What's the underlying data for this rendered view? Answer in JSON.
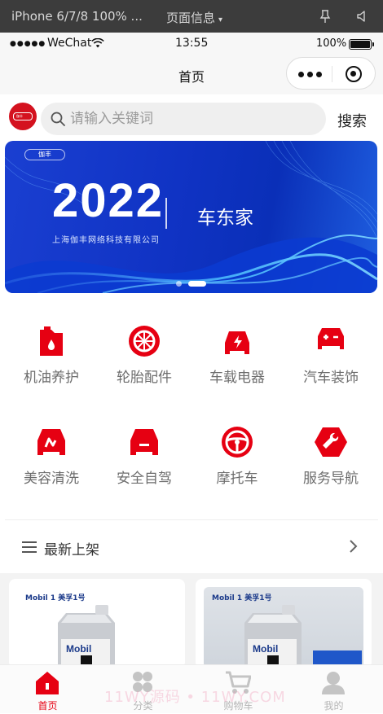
{
  "devtools": {
    "device_label": "iPhone 6/7/8 100% ...",
    "page_info_label": "页面信息",
    "pin_icon": "pin-icon",
    "volume_icon": "volume-icon"
  },
  "status_bar": {
    "signal": "●●●●●",
    "carrier": "WeChat",
    "time": "13:55",
    "battery": "100%"
  },
  "nav": {
    "title": "首页"
  },
  "search": {
    "logo_text": "伽丰",
    "placeholder": "请输入关键词",
    "button_label": "搜索"
  },
  "banner": {
    "logo_text": "伽丰",
    "year": "2022",
    "brand": "车东家",
    "company": "上海伽丰网络科技有限公司",
    "slide_count": 2,
    "active_slide": 2
  },
  "categories": [
    {
      "label": "机油养护",
      "icon": "oil-can-icon"
    },
    {
      "label": "轮胎配件",
      "icon": "tire-icon"
    },
    {
      "label": "车载电器",
      "icon": "car-electric-icon"
    },
    {
      "label": "汽车装饰",
      "icon": "car-battery-icon"
    },
    {
      "label": "美容清洗",
      "icon": "car-wash-icon"
    },
    {
      "label": "安全自驾",
      "icon": "car-safety-icon"
    },
    {
      "label": "摩托车",
      "icon": "steering-wheel-icon"
    },
    {
      "label": "服务导航",
      "icon": "wrench-icon"
    }
  ],
  "section": {
    "title": "最新上架"
  },
  "products": [
    {
      "brand": "Mobil 1 美孚1号",
      "badge": "Mobil"
    },
    {
      "brand": "Mobil 1 美孚1号",
      "badge": "Mobil"
    }
  ],
  "tabs": [
    {
      "label": "首页",
      "icon": "home-icon",
      "active": true
    },
    {
      "label": "分类",
      "icon": "category-icon",
      "active": false
    },
    {
      "label": "购物车",
      "icon": "cart-icon",
      "active": false
    },
    {
      "label": "我的",
      "icon": "user-icon",
      "active": false
    }
  ],
  "watermark": "11WY源码 • 11WY.COM",
  "colors": {
    "accent": "#e60012",
    "banner": "#1033c4",
    "inactive_tab": "#b5b5b5"
  }
}
